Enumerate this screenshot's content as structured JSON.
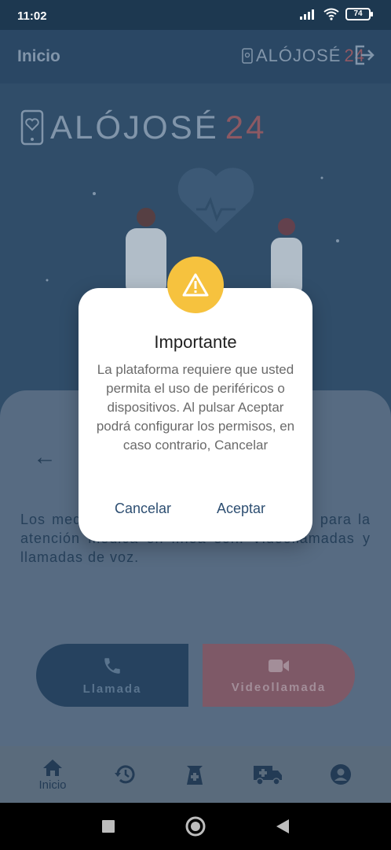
{
  "status_bar": {
    "time": "11:02",
    "battery": "74"
  },
  "app_bar": {
    "title": "Inicio",
    "logo_text": "ALÓJOSÉ",
    "logo_number": "24"
  },
  "hero": {
    "logo_text": "ALÓJOSÉ",
    "logo_number": "24"
  },
  "main": {
    "description": "Los medios de comunicación disponibles para la atención médica en línea son: Videollamadas y llamadas de voz.",
    "call_button": "Llamada",
    "video_button": "Videollamada"
  },
  "bottom_nav": {
    "items": [
      {
        "label": "Inicio",
        "icon": "home-icon"
      },
      {
        "label": "",
        "icon": "history-icon"
      },
      {
        "label": "",
        "icon": "prescription-icon"
      },
      {
        "label": "",
        "icon": "ambulance-icon"
      },
      {
        "label": "",
        "icon": "account-icon"
      }
    ]
  },
  "dialog": {
    "title": "Importante",
    "message": "La plataforma requiere que usted permita el uso de periféricos o dispositivos. Al pulsar Aceptar podrá configurar los permisos, en caso contrario, Cancelar",
    "cancel_label": "Cancelar",
    "accept_label": "Aceptar",
    "icon": "warning-icon"
  },
  "colors": {
    "primary": "#244462",
    "accent_red": "#a05a62",
    "warning": "#f6c23e",
    "dialog_button": "#2e4f72"
  }
}
